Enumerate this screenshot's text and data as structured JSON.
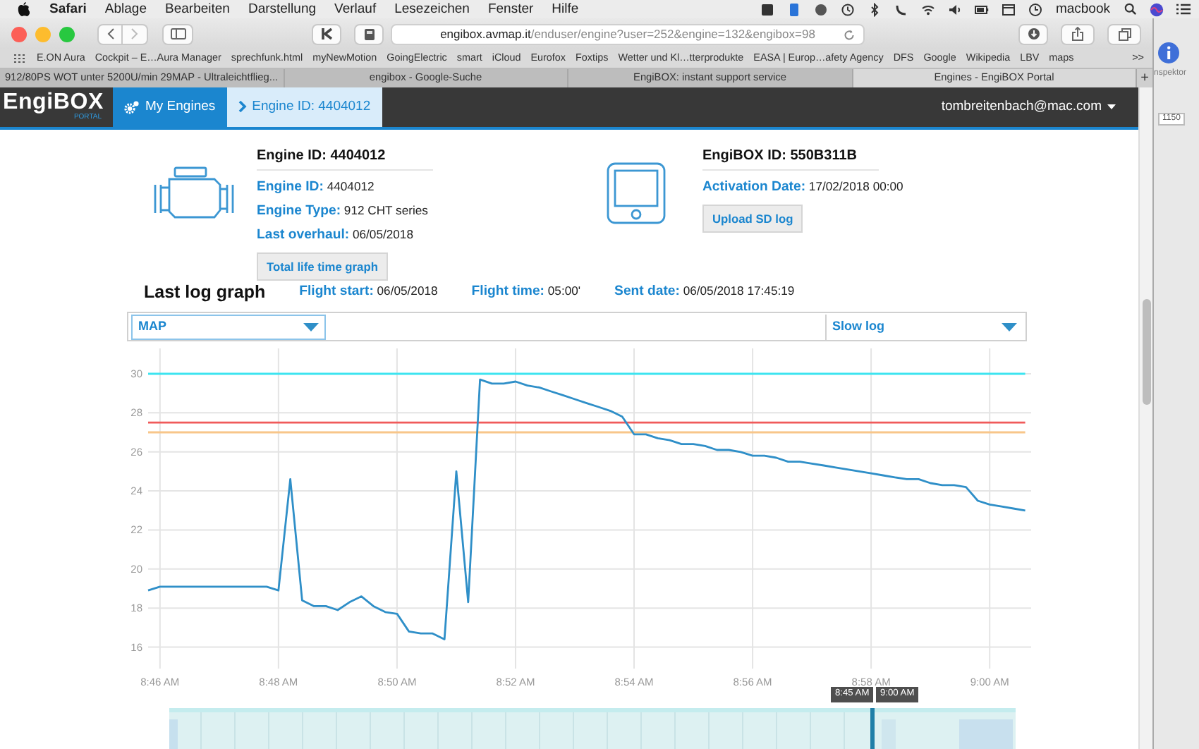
{
  "menubar": {
    "app": "Safari",
    "menus": [
      "Ablage",
      "Bearbeiten",
      "Darstellung",
      "Verlauf",
      "Lesezeichen",
      "Fenster",
      "Hilfe"
    ],
    "computer_name": "macbook"
  },
  "browser": {
    "address": {
      "domain": "engibox.avmap.it",
      "path": "/enduser/engine?user=252&engine=132&engibox=98"
    },
    "bookmarks": [
      "E.ON Aura",
      "Cockpit – E…Aura Manager",
      "sprechfunk.html",
      "myNewMotion",
      "GoingElectric",
      "smart",
      "iCloud",
      "Eurofox",
      "Foxtips",
      "Wetter und Kl…tterprodukte",
      "EASA | Europ…afety Agency",
      "DFS",
      "Google",
      "Wikipedia",
      "LBV",
      "maps"
    ],
    "more_bookmarks": ">>",
    "tabs": [
      {
        "title": "912/80PS WOT unter 5200U/min 29MAP - Ultraleichtflieg...",
        "selected": false
      },
      {
        "title": "engibox - Google-Suche",
        "selected": false
      },
      {
        "title": "EngiBOX: instant support service",
        "selected": false
      },
      {
        "title": "Engines - EngiBOX Portal",
        "selected": true
      }
    ],
    "new_tab": "+"
  },
  "portal": {
    "logo": {
      "name": "EngiBOX",
      "sub": "PORTAL"
    },
    "nav": [
      {
        "label": "My Engines",
        "kind": "home"
      },
      {
        "label": "Engine ID: 4404012",
        "kind": "crumb"
      }
    ],
    "user_menu": "tombreitenbach@mac.com",
    "engine": {
      "heading": "Engine ID: 4404012",
      "fields": [
        {
          "label": "Engine ID:",
          "value": "4404012"
        },
        {
          "label": "Engine Type:",
          "value": "912 CHT series"
        },
        {
          "label": "Last overhaul:",
          "value": "06/05/2018"
        }
      ],
      "button": "Total life time graph"
    },
    "engibox": {
      "heading": "EngiBOX ID: 550B311B",
      "fields": [
        {
          "label": "Activation Date:",
          "value": "17/02/2018 00:00"
        }
      ],
      "button": "Upload SD log"
    },
    "log": {
      "title": "Last log graph",
      "meta": [
        {
          "label": "Flight start:",
          "value": "06/05/2018"
        },
        {
          "label": "Flight time:",
          "value": "05:00'"
        },
        {
          "label": "Sent date:",
          "value": "06/05/2018 17:45:19"
        }
      ],
      "channel_select": "MAP",
      "log_select": "Slow log",
      "chart_data": {
        "type": "line",
        "categories": [
          null,
          "8:46 AM",
          null,
          null,
          null,
          null,
          null,
          null,
          null,
          null,
          null,
          "8:48 AM",
          null,
          null,
          null,
          null,
          null,
          null,
          null,
          null,
          null,
          "8:50 AM",
          null,
          null,
          null,
          null,
          null,
          null,
          null,
          null,
          null,
          "8:52 AM",
          null,
          null,
          null,
          null,
          null,
          null,
          null,
          null,
          null,
          "8:54 AM",
          null,
          null,
          null,
          null,
          null,
          null,
          null,
          null,
          null,
          "8:56 AM",
          null,
          null,
          null,
          null,
          null,
          null,
          null,
          null,
          null,
          "8:58 AM",
          null,
          null,
          null,
          null,
          null,
          null,
          null,
          null,
          null,
          "9:00 AM",
          null,
          null,
          null
        ],
        "series": [
          {
            "color": "#2f8fc8",
            "values": [
              18.9,
              19.1,
              19.1,
              19.1,
              19.1,
              19.1,
              19.1,
              19.1,
              19.1,
              19.1,
              19.1,
              18.9,
              24.6,
              18.4,
              18.1,
              18.1,
              17.9,
              18.3,
              18.6,
              18.1,
              17.8,
              17.7,
              16.8,
              16.7,
              16.7,
              16.4,
              25.0,
              18.3,
              29.7,
              29.5,
              29.5,
              29.6,
              29.4,
              29.3,
              29.1,
              28.9,
              28.7,
              28.5,
              28.3,
              28.1,
              27.8,
              26.9,
              26.9,
              26.7,
              26.6,
              26.4,
              26.4,
              26.3,
              26.1,
              26.1,
              26.0,
              25.8,
              25.8,
              25.7,
              25.5,
              25.5,
              25.4,
              25.3,
              25.2,
              25.1,
              25.0,
              24.9,
              24.8,
              24.7,
              24.6,
              24.6,
              24.4,
              24.3,
              24.3,
              24.2,
              23.5,
              23.3,
              23.2,
              23.1,
              23.0
            ]
          },
          {
            "color": "#3de4f0",
            "values": [
              30,
              30,
              30,
              30,
              30,
              30,
              30,
              30,
              30,
              30,
              30,
              30,
              30,
              30,
              30,
              30,
              30,
              30,
              30,
              30,
              30,
              30,
              30,
              30,
              30,
              30,
              30,
              30,
              30,
              30,
              30,
              30,
              30,
              30,
              30,
              30,
              30,
              30,
              30,
              30,
              30,
              30,
              30,
              30,
              30,
              30,
              30,
              30,
              30,
              30,
              30,
              30,
              30,
              30,
              30,
              30,
              30,
              30,
              30,
              30,
              30,
              30,
              30,
              30,
              30,
              30,
              30,
              30,
              30,
              30,
              30,
              30,
              30,
              30,
              30
            ]
          },
          {
            "color": "#f05a5a",
            "values": [
              27.5,
              27.5,
              27.5,
              27.5,
              27.5,
              27.5,
              27.5,
              27.5,
              27.5,
              27.5,
              27.5,
              27.5,
              27.5,
              27.5,
              27.5,
              27.5,
              27.5,
              27.5,
              27.5,
              27.5,
              27.5,
              27.5,
              27.5,
              27.5,
              27.5,
              27.5,
              27.5,
              27.5,
              27.5,
              27.5,
              27.5,
              27.5,
              27.5,
              27.5,
              27.5,
              27.5,
              27.5,
              27.5,
              27.5,
              27.5,
              27.5,
              27.5,
              27.5,
              27.5,
              27.5,
              27.5,
              27.5,
              27.5,
              27.5,
              27.5,
              27.5,
              27.5,
              27.5,
              27.5,
              27.5,
              27.5,
              27.5,
              27.5,
              27.5,
              27.5,
              27.5,
              27.5,
              27.5,
              27.5,
              27.5,
              27.5,
              27.5,
              27.5,
              27.5,
              27.5,
              27.5,
              27.5,
              27.5,
              27.5,
              27.5
            ]
          },
          {
            "color": "#f8c68a",
            "values": [
              27,
              27,
              27,
              27,
              27,
              27,
              27,
              27,
              27,
              27,
              27,
              27,
              27,
              27,
              27,
              27,
              27,
              27,
              27,
              27,
              27,
              27,
              27,
              27,
              27,
              27,
              27,
              27,
              27,
              27,
              27,
              27,
              27,
              27,
              27,
              27,
              27,
              27,
              27,
              27,
              27,
              27,
              27,
              27,
              27,
              27,
              27,
              27,
              27,
              27,
              27,
              27,
              27,
              27,
              27,
              27,
              27,
              27,
              27,
              27,
              27,
              27,
              27,
              27,
              27,
              27,
              27,
              27,
              27,
              27,
              27,
              27,
              27,
              27,
              27
            ]
          }
        ],
        "grid": true,
        "ylim": [
          14.9,
          31.3
        ],
        "yticks": [
          16,
          18,
          20,
          22,
          24,
          26,
          28,
          30
        ]
      },
      "navigator": {
        "from": "8:45 AM",
        "to": "9:00 AM"
      }
    }
  },
  "side_app": {
    "inspector_label": "nspektor",
    "ruler_value": "1150"
  }
}
